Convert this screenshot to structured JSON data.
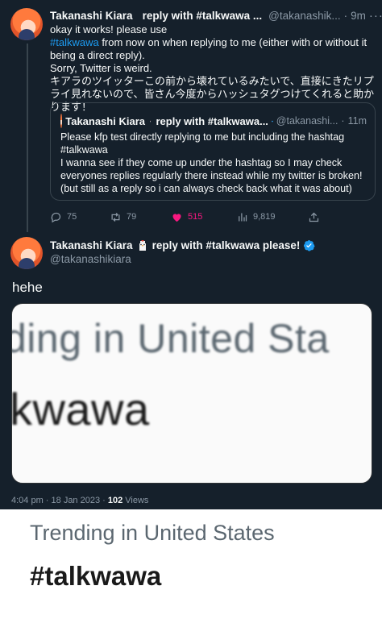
{
  "tweet1": {
    "name": "Takanashi Kiara",
    "name_suffix": "reply with #talkwawa ...",
    "handle": "@takanashik...",
    "time": "9m",
    "line1": "okay it works! please use",
    "hashtag": "#talkwawa",
    "line2_rest": " from now on when replying to me (either with or without it being a direct reply).",
    "line3": "Sorry, Twitter is weird.",
    "line4": "キアラのツイッターこの前から壊れているみたいで、直接にきたリプライ見れないので、皆さん今度からハッシュタグつけてくれると助かります！"
  },
  "quote": {
    "name": "Takanashi Kiara",
    "name_suffix": "reply with #talkwawa...",
    "handle": "@takanashi...",
    "time": "11m",
    "line1": "Please kfp test directly replying to me but including the hashtag",
    "line2": "#talkwawa",
    "line3": "I wanna see if they come up under the hashtag so I may check everyones replies regularly there instead while my twitter is broken! (but still as a reply so i can always check back what it was about)"
  },
  "actions": {
    "replies": "75",
    "retweets": "79",
    "likes": "515",
    "views": "9,819"
  },
  "tweet2": {
    "name": "Takanashi Kiara",
    "name_suffix": "reply with #talkwawa please!",
    "handle": "@takanashikiara",
    "text": "hehe",
    "image_line1": "ding in United Sta",
    "image_line2": "lkwawa",
    "time": "4:04 pm · 18 Jan 2023 · ",
    "views_count": "102",
    "views_label": " Views"
  },
  "bottom_image": {
    "trending": "Trending in United States",
    "tag": "#talkwawa"
  },
  "colors": {
    "background": "#15202b",
    "link": "#1d9bf0",
    "like": "#f91880",
    "muted": "#8b98a5"
  }
}
